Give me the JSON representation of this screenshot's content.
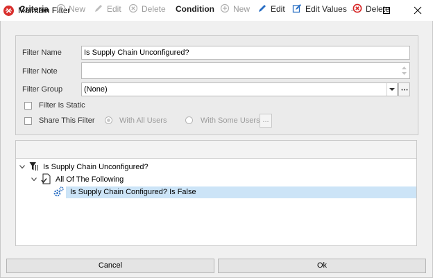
{
  "window": {
    "title": "Maintain Filter"
  },
  "form": {
    "filter_name_label": "Filter Name",
    "filter_name_value": "Is Supply Chain Unconfigured?",
    "filter_note_label": "Filter Note",
    "filter_note_value": "",
    "filter_group_label": "Filter Group",
    "filter_group_value": "(None)",
    "filter_is_static_label": "Filter Is Static",
    "filter_is_static_checked": false,
    "share_label": "Share This Filter",
    "share_checked": false,
    "with_all_users_label": "With All Users",
    "with_some_users_label": "With Some Users",
    "ellipsis_label": "..."
  },
  "toolbar": {
    "criteria_label": "Criteria",
    "criteria_new": "New",
    "criteria_edit": "Edit",
    "criteria_delete": "Delete",
    "condition_label": "Condition",
    "condition_new": "New",
    "condition_edit": "Edit",
    "condition_edit_values": "Edit Values",
    "condition_delete": "Delete"
  },
  "tree": {
    "root": "Is Supply Chain Unconfigured?",
    "group": "All Of The Following",
    "condition": "Is Supply Chain Configured? Is False"
  },
  "buttons": {
    "cancel": "Cancel",
    "ok": "Ok"
  },
  "colors": {
    "app_icon": "#d9302e",
    "selection": "#cce4f7",
    "edit_blue": "#2a6fc4",
    "delete_red": "#d62424"
  }
}
